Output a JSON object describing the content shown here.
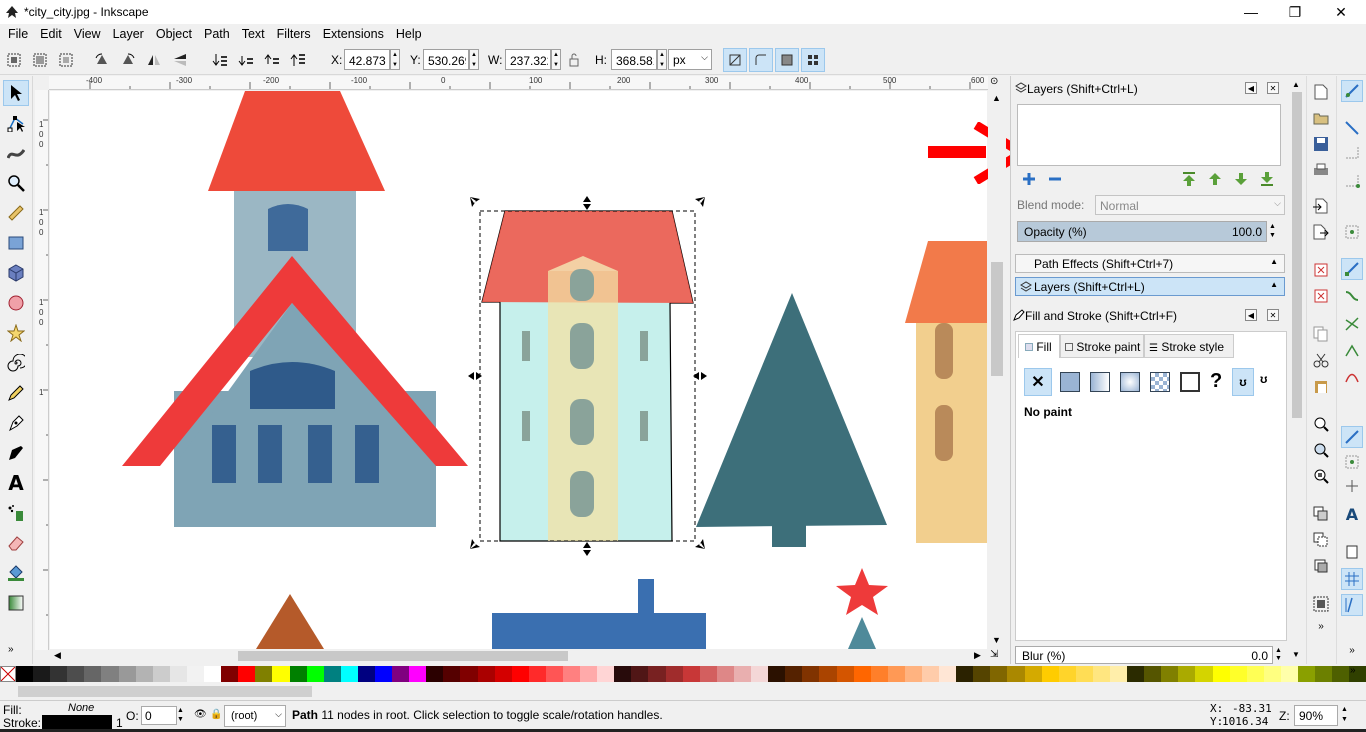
{
  "window": {
    "title": "*city_city.jpg - Inkscape",
    "minimize": "—",
    "maximize": "❐",
    "close": "✕"
  },
  "menu": [
    "File",
    "Edit",
    "View",
    "Layer",
    "Object",
    "Path",
    "Text",
    "Filters",
    "Extensions",
    "Help"
  ],
  "toolbar": {
    "x_label": "X:",
    "x_value": "42.873",
    "y_label": "Y:",
    "y_value": "530.269",
    "w_label": "W:",
    "w_value": "237.322",
    "h_label": "H:",
    "h_value": "368.581",
    "unit": "px"
  },
  "ruler": {
    "h_ticks": [
      "-400",
      "-300",
      "-200",
      "-100",
      "0",
      "100",
      "200",
      "300",
      "400",
      "500",
      "600"
    ],
    "v_ticks": [
      "1",
      "0",
      "0",
      "1",
      "0",
      "0",
      "1",
      "0",
      "0",
      "1"
    ]
  },
  "layers_panel": {
    "title": "Layers (Shift+Ctrl+L)",
    "blend_label": "Blend mode:",
    "blend_value": "Normal",
    "opacity_label": "Opacity (%)",
    "opacity_value": "100.0",
    "opacity_level": 1.0
  },
  "dock_tabs": {
    "path_effects": "Path Effects  (Shift+Ctrl+7)",
    "layers": "Layers (Shift+Ctrl+L)"
  },
  "fill_stroke": {
    "title": "Fill and Stroke (Shift+Ctrl+F)",
    "tab_fill": "Fill",
    "tab_stroke_paint": "Stroke paint",
    "tab_stroke_style": "Stroke style",
    "paint_status": "No paint",
    "blur_label": "Blur (%)",
    "blur_value": "0.0"
  },
  "status": {
    "fill_label": "Fill:",
    "fill_value": "None",
    "stroke_label": "Stroke:",
    "stroke_width": "1",
    "opacity_label": "O:",
    "opacity_value": "0",
    "layer_value": "(root)",
    "message_bold": "Path",
    "message": " 11 nodes in root. Click selection to toggle scale/rotation handles.",
    "cursor_x_label": "X:",
    "cursor_x": "-83.31",
    "cursor_y_label": "Y:",
    "cursor_y": "1016.34",
    "zoom_label": "Z:",
    "zoom_value": "90%"
  },
  "palette": [
    "#000000",
    "#1a1a1a",
    "#333333",
    "#4d4d4d",
    "#666666",
    "#808080",
    "#999999",
    "#b3b3b3",
    "#cccccc",
    "#e6e6e6",
    "#f2f2f2",
    "#ffffff",
    "#800000",
    "#ff0000",
    "#808000",
    "#ffff00",
    "#008000",
    "#00ff00",
    "#008080",
    "#00ffff",
    "#000080",
    "#0000ff",
    "#800080",
    "#ff00ff",
    "#2b0000",
    "#550000",
    "#800000",
    "#aa0000",
    "#d40000",
    "#ff0000",
    "#ff2a2a",
    "#ff5555",
    "#ff8080",
    "#ffaaaa",
    "#ffd5d5",
    "#280b0b",
    "#501616",
    "#782121",
    "#a02c2c",
    "#c83737",
    "#d35f5f",
    "#de8787",
    "#e9afaf",
    "#f4d7d7",
    "#2b1100",
    "#552200",
    "#803300",
    "#aa4400",
    "#d45500",
    "#ff6600",
    "#ff7f2a",
    "#ff9955",
    "#ffb380",
    "#ffccaa",
    "#ffe6d5",
    "#2b2200",
    "#554400",
    "#806600",
    "#aa8800",
    "#d4aa00",
    "#ffcc00",
    "#ffd42a",
    "#ffdd55",
    "#ffe680",
    "#ffeeaa",
    "#2b2b00",
    "#555500",
    "#808000",
    "#aaaa00",
    "#d4d400",
    "#ffff00",
    "#ffff2a",
    "#ffff55",
    "#ffff80",
    "#ffffaa",
    "#8aa000",
    "#6c8000",
    "#4e6000",
    "#304000"
  ],
  "icons": {
    "selected_tool": "selector-arrow-icon",
    "annotation": "red-arrow"
  },
  "colors": {
    "accent": "#cce4f7",
    "annotation_red": "#ff0000"
  }
}
